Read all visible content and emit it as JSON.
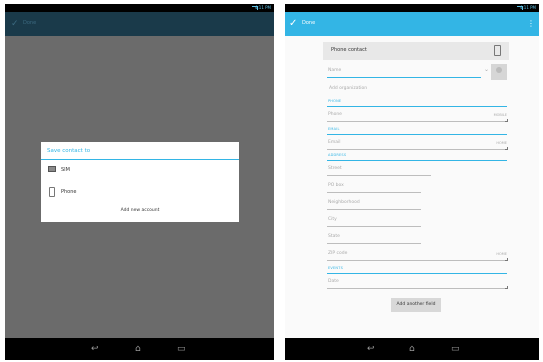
{
  "left": {
    "status_text": "4:11 PM",
    "actionbar_title": "Done",
    "dialog": {
      "title": "Save contact to",
      "options": [
        {
          "label": "SIM",
          "icon": "sim-card-icon"
        },
        {
          "label": "Phone",
          "icon": "phone-icon"
        }
      ],
      "footer": "Add new account"
    }
  },
  "right": {
    "status_text": "4:11 PM",
    "actionbar_title": "Done",
    "account": {
      "label": "Phone contact",
      "icon": "phone-icon"
    },
    "name_placeholder": "Name",
    "add_org": "Add organization",
    "sections": {
      "phone": "PHONE",
      "email": "EMAIL",
      "address": "ADDRESS",
      "events": "EVENTS"
    },
    "phone_placeholder": "Phone",
    "phone_type": "MOBILE",
    "email_placeholder": "Email",
    "email_type": "HOME",
    "address_fields": [
      "Street",
      "PO box",
      "Neighborhood",
      "City",
      "State",
      "ZIP code"
    ],
    "address_type": "HOME",
    "events_placeholder": "Date",
    "add_field_button": "Add another field"
  },
  "nav_icons": [
    "back-icon",
    "home-icon",
    "recent-apps-icon"
  ]
}
